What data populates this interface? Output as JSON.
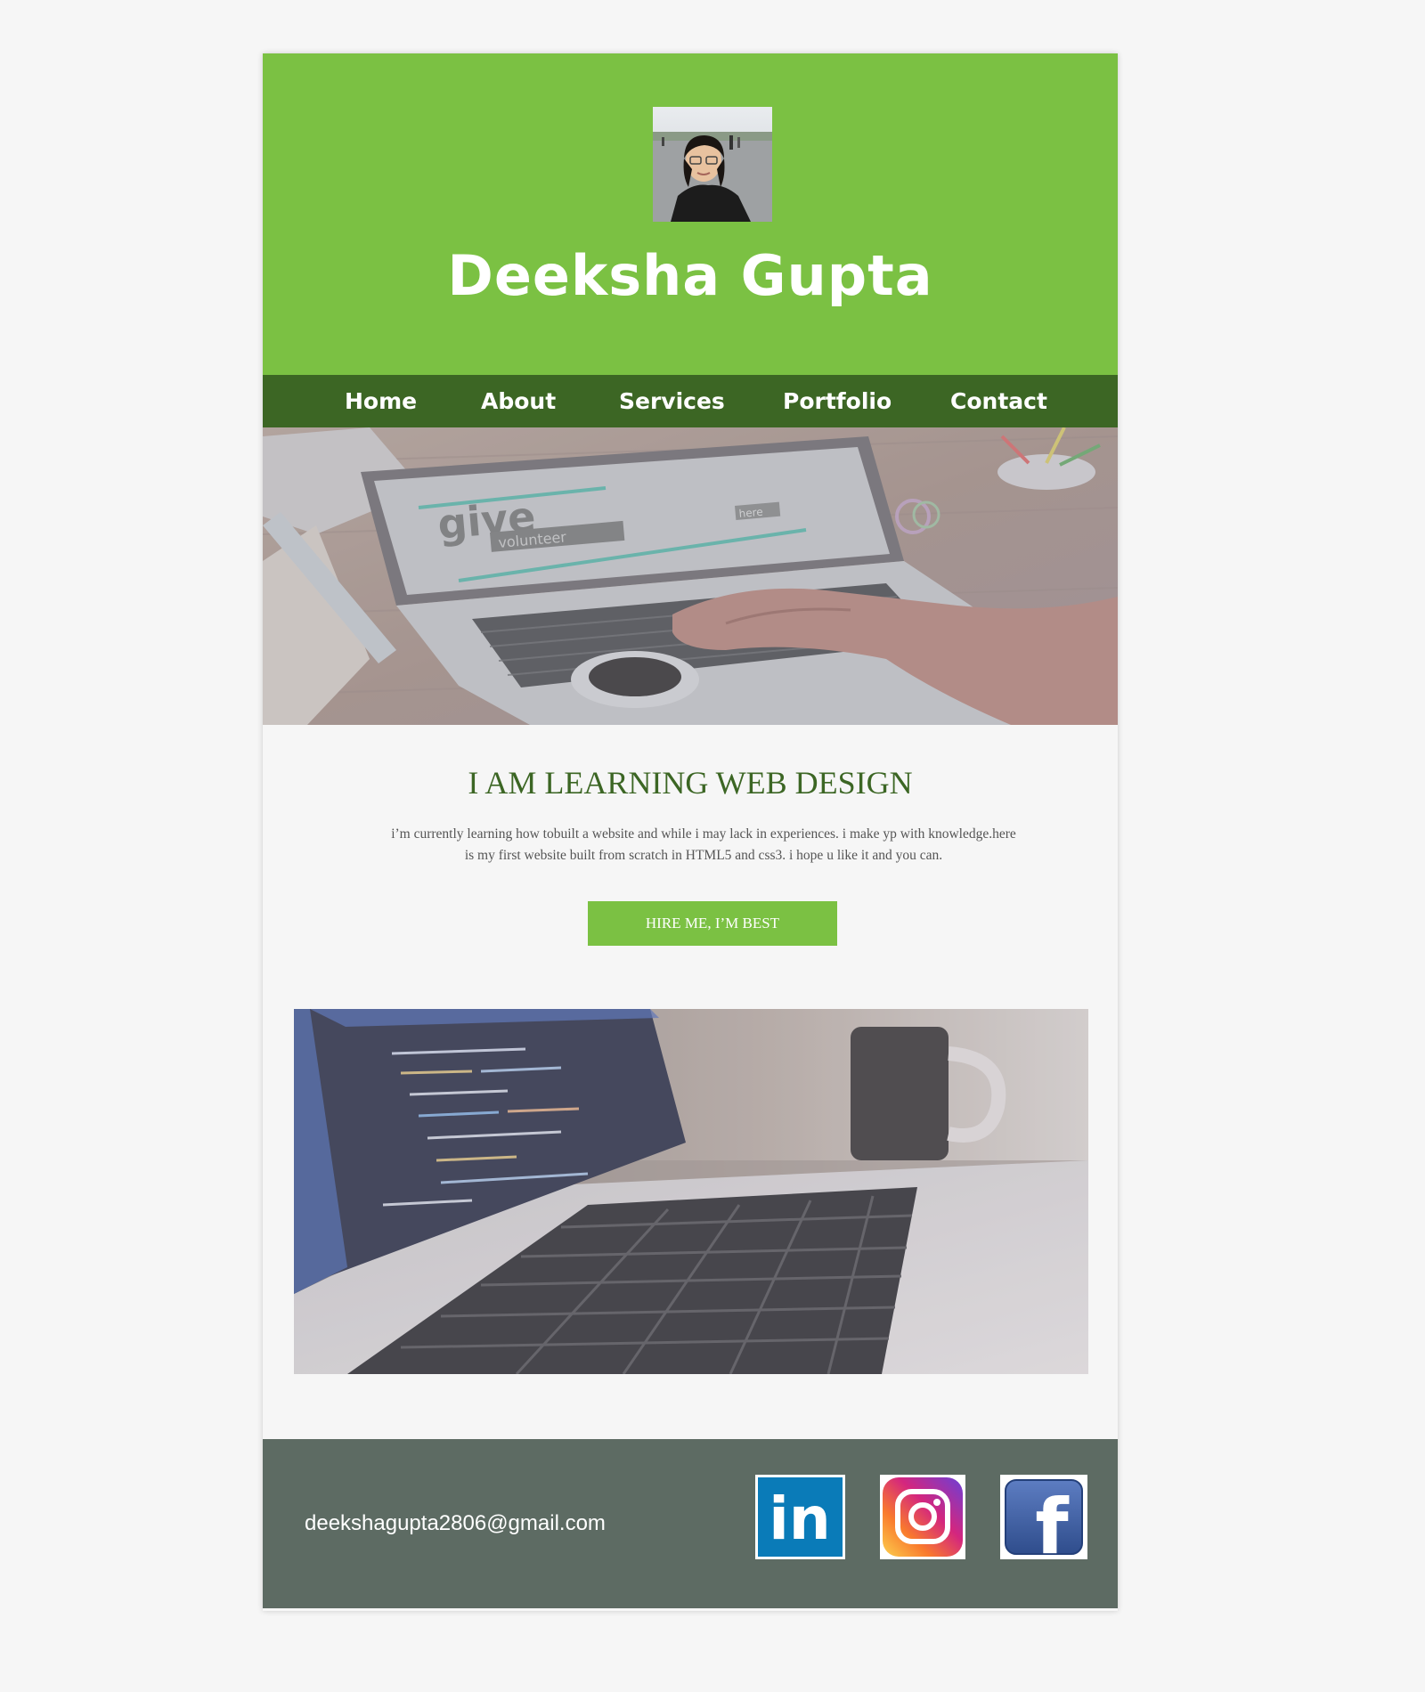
{
  "header": {
    "name": "Deeksha Gupta",
    "avatar_icon": "profile-photo"
  },
  "nav": {
    "items": [
      {
        "label": "Home"
      },
      {
        "label": "About"
      },
      {
        "label": "Services"
      },
      {
        "label": "Portfolio"
      },
      {
        "label": "Contact"
      }
    ]
  },
  "hero": {
    "screen_text_1": "give",
    "screen_text_2": "volunteer",
    "screen_text_3": "here"
  },
  "intro": {
    "heading": "I AM LEARNING WEB DESIGN",
    "text_line_1": "i’m currently learning how tobuilt a website and while i may lack in  experiences. i make yp with knowledge.here",
    "text_line_2": "is my first website built from scratch in HTML5 and css3. i hope u like it and you can.",
    "cta_label": "HIRE ME, I’M BEST"
  },
  "footer": {
    "email": "deekshagupta2806@gmail.com",
    "social": [
      {
        "icon": "linkedin-icon",
        "glyph": "in"
      },
      {
        "icon": "instagram-icon"
      },
      {
        "icon": "facebook-icon",
        "glyph": "f"
      }
    ]
  },
  "colors": {
    "header_green": "#7bc143",
    "nav_dark_green": "#3c6624",
    "footer_gray": "#5d6b63",
    "page_bg": "#f6f6f6",
    "linkedin_blue": "#0a7bb8",
    "facebook_blue": "#3b5998"
  }
}
